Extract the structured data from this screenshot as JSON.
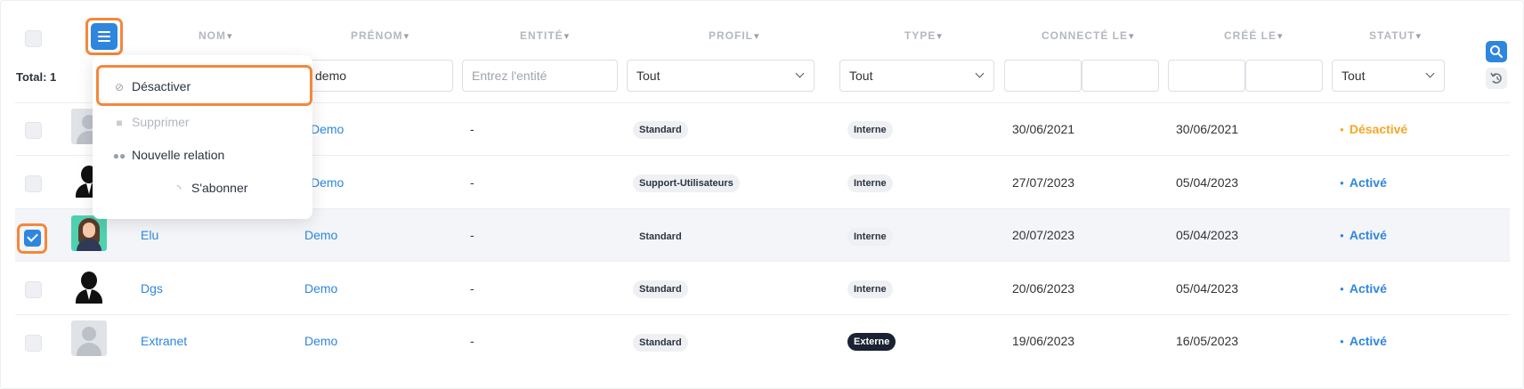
{
  "columns": {
    "nom": "NOM",
    "prenom": "PRÉNOM",
    "entite": "ENTITÉ",
    "profil": "PROFIL",
    "type": "TYPE",
    "connecte_le": "CONNECTÉ LE",
    "cree_le": "CRÉÉ LE",
    "statut": "STATUT"
  },
  "icons": {
    "sort": "chevron-down-icon",
    "menu": "hamburger-menu-icon",
    "search": "search-icon",
    "reset": "reset-icon"
  },
  "total": "Total: 1",
  "filters": {
    "prenom_value": "demo",
    "entite_placeholder": "Entrez l'entité",
    "profil_value": "Tout",
    "type_value": "Tout",
    "statut_value": "Tout"
  },
  "dropdown": {
    "items": [
      {
        "label": "Désactiver",
        "icon": "ban-icon"
      },
      {
        "label": "Supprimer",
        "icon": "trash-icon"
      },
      {
        "label": "Nouvelle relation",
        "icon": "users-icon"
      },
      {
        "label": "S'abonner",
        "icon": "rss-icon"
      }
    ]
  },
  "rows": [
    {
      "nom": "",
      "prenom": "Demo",
      "entite": "-",
      "profil": "Standard",
      "type": "Interne",
      "connecte": "30/06/2021",
      "cree": "30/06/2021",
      "statut": "Désactivé",
      "selected": false
    },
    {
      "nom": "",
      "prenom": "Demo",
      "entite": "-",
      "profil": "Support-Utilisateurs",
      "type": "Interne",
      "connecte": "27/07/2023",
      "cree": "05/04/2023",
      "statut": "Activé",
      "selected": false
    },
    {
      "nom": "Elu",
      "prenom": "Demo",
      "entite": "-",
      "profil": "Standard",
      "type": "Interne",
      "connecte": "20/07/2023",
      "cree": "05/04/2023",
      "statut": "Activé",
      "selected": true
    },
    {
      "nom": "Dgs",
      "prenom": "Demo",
      "entite": "-",
      "profil": "Standard",
      "type": "Interne",
      "connecte": "20/06/2023",
      "cree": "05/04/2023",
      "statut": "Activé",
      "selected": false
    },
    {
      "nom": "Extranet",
      "prenom": "Demo",
      "entite": "-",
      "profil": "Standard",
      "type": "Externe",
      "connecte": "19/06/2023",
      "cree": "16/05/2023",
      "statut": "Activé",
      "selected": false
    }
  ],
  "colors": {
    "accent": "#2e86de",
    "highlight": "#f5873b",
    "status_active": "#2e86de",
    "status_inactive": "#f5a623"
  }
}
